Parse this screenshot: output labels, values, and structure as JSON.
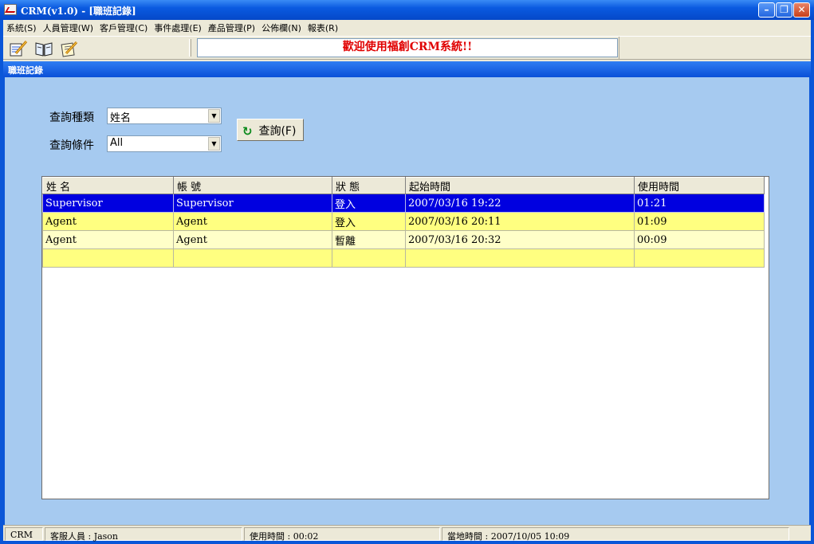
{
  "window": {
    "title": "CRM(v1.0) - [職班記錄]",
    "minimize": "–",
    "restore": "❐",
    "close": "✕"
  },
  "menu": [
    "系統(S)",
    "人員管理(W)",
    "客戶管理(C)",
    "事件處理(E)",
    "產品管理(P)",
    "公佈欄(N)",
    "報表(R)"
  ],
  "toolbar": {
    "icons": [
      "edit-icon",
      "book-icon",
      "notes-icon"
    ],
    "welcome": "歡迎使用福創CRM系統!!"
  },
  "form": {
    "title": "職班記錄",
    "query_type_label": "查詢種類",
    "query_type_value": "姓名",
    "query_cond_label": "查詢條件",
    "query_cond_value": "All",
    "query_button": "查詢(F)"
  },
  "grid": {
    "columns": [
      "姓  名",
      "帳    號",
      "狀 態",
      "起始時間",
      "使用時間"
    ],
    "rows": [
      [
        "Supervisor",
        "Supervisor",
        "登入",
        "2007/03/16 19:22",
        "01:21"
      ],
      [
        "Agent",
        "Agent",
        "登入",
        "2007/03/16 20:11",
        "01:09"
      ],
      [
        "Agent",
        "Agent",
        "暫離",
        "2007/03/16 20:32",
        "00:09"
      ],
      [
        "",
        "",
        "",
        "",
        ""
      ]
    ]
  },
  "status": {
    "app": "CRM",
    "agent": "客服人員 : Jason",
    "usage": "使用時間 : 00:02",
    "local_time": "當地時間 : 2007/10/05 10:09"
  },
  "colors": {
    "selected_row": "#0000e0",
    "row_yellow": "#ffff80",
    "row_light_yellow": "#ffffc8",
    "form_bg": "#a6caf0",
    "welcome_text": "#e00000"
  }
}
